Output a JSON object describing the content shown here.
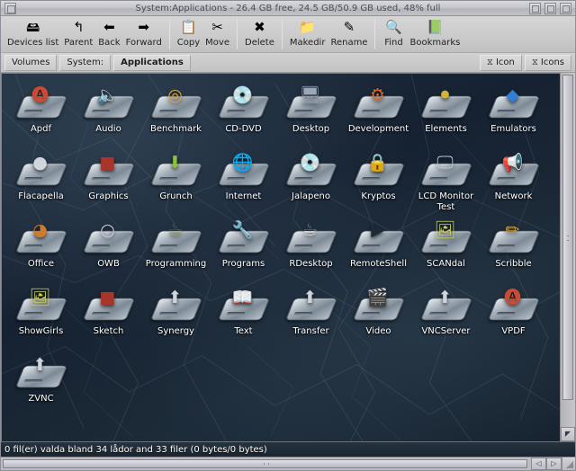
{
  "window": {
    "title": "System:Applications - 26.4 GB free, 24.5 GB/50.9 GB used, 48% full",
    "close_label": "",
    "iconify_label": "",
    "zoom_label": "",
    "depth_label": ""
  },
  "toolbar": {
    "items": [
      {
        "label": "Devices list",
        "icon": "devices-list-icon",
        "glyph": "🖴"
      },
      {
        "label": "Parent",
        "icon": "parent-arrow-icon",
        "glyph": "↰"
      },
      {
        "label": "Back",
        "icon": "back-arrow-icon",
        "glyph": "⬅"
      },
      {
        "label": "Forward",
        "icon": "forward-arrow-icon",
        "glyph": "➡"
      },
      {
        "label": "Copy",
        "icon": "copy-icon",
        "glyph": "📋"
      },
      {
        "label": "Move",
        "icon": "move-icon",
        "glyph": "✂"
      },
      {
        "label": "Delete",
        "icon": "delete-icon",
        "glyph": "✖"
      },
      {
        "label": "Makedir",
        "icon": "makedir-icon",
        "glyph": "📁"
      },
      {
        "label": "Rename",
        "icon": "rename-pencil-icon",
        "glyph": "✎"
      },
      {
        "label": "Find",
        "icon": "find-magnifier-icon",
        "glyph": "🔍"
      },
      {
        "label": "Bookmarks",
        "icon": "bookmarks-icon",
        "glyph": "📗"
      }
    ],
    "separators_after": [
      3,
      5,
      6,
      8
    ]
  },
  "pathbar": {
    "crumbs": [
      {
        "label": "Volumes",
        "current": false
      },
      {
        "label": "System:",
        "current": false
      },
      {
        "label": "Applications",
        "current": true
      }
    ],
    "view_buttons": [
      {
        "label": "Icon",
        "icon": "hourglass-icon"
      },
      {
        "label": "Icons",
        "icon": "hourglass-icon"
      }
    ]
  },
  "files": {
    "items": [
      {
        "name": "Apdf",
        "glyph": "🅐",
        "color": "#c94a35"
      },
      {
        "name": "Audio",
        "glyph": "🔈",
        "color": "#6b6b55"
      },
      {
        "name": "Benchmark",
        "glyph": "◎",
        "color": "#d9a43a"
      },
      {
        "name": "CD-DVD",
        "glyph": "💿",
        "color": "#d8d8d0"
      },
      {
        "name": "Desktop",
        "glyph": "🖥",
        "color": "#9aa8b8"
      },
      {
        "name": "Development",
        "glyph": "⚙",
        "color": "#d96a2a"
      },
      {
        "name": "Elements",
        "glyph": "⚫",
        "color": "#d2b23a"
      },
      {
        "name": "Emulators",
        "glyph": "◆",
        "color": "#2f7fd4"
      },
      {
        "name": "Flacapella",
        "glyph": "●",
        "color": "#cfd6dc"
      },
      {
        "name": "Graphics",
        "glyph": "■",
        "color": "#a8352a"
      },
      {
        "name": "Grunch",
        "glyph": "⬇",
        "color": "#8cc23a"
      },
      {
        "name": "Internet",
        "glyph": "🌐",
        "color": "#6fa8d6"
      },
      {
        "name": "Jalapeno",
        "glyph": "💿",
        "color": "#d0d6dc"
      },
      {
        "name": "Kryptos",
        "glyph": "🔒",
        "color": "#d2a02e"
      },
      {
        "name": "LCD Monitor Test",
        "glyph": "🖵",
        "color": "#bcc6d0"
      },
      {
        "name": "Network",
        "glyph": "📢",
        "color": "#d8cfc2"
      },
      {
        "name": "Office",
        "glyph": "◕",
        "color": "#cf7a2c"
      },
      {
        "name": "OWB",
        "glyph": "○",
        "color": "#c8cfd6"
      },
      {
        "name": "Programming",
        "glyph": "☕",
        "color": "#97a05e"
      },
      {
        "name": "Programs",
        "glyph": "🔧",
        "color": "#c6c2b4"
      },
      {
        "name": "RDesktop",
        "glyph": "☕",
        "color": "#ddd6cc"
      },
      {
        "name": "RemoteShell",
        "glyph": "▶",
        "color": "#1e2a34"
      },
      {
        "name": "SCANdal",
        "glyph": "🖼",
        "color": "#c8cf52"
      },
      {
        "name": "Scribble",
        "glyph": "✏",
        "color": "#e0a830"
      },
      {
        "name": "ShowGirls",
        "glyph": "🖼",
        "color": "#c8cf52"
      },
      {
        "name": "Sketch",
        "glyph": "■",
        "color": "#a8352a"
      },
      {
        "name": "Synergy",
        "glyph": "⬆",
        "color": "#cdd4dc"
      },
      {
        "name": "Text",
        "glyph": "📖",
        "color": "#ddd2be"
      },
      {
        "name": "Transfer",
        "glyph": "⬆",
        "color": "#cdd4dc"
      },
      {
        "name": "Video",
        "glyph": "🎬",
        "color": "#cfd6dc"
      },
      {
        "name": "VNCServer",
        "glyph": "⬆",
        "color": "#cdd4dc"
      },
      {
        "name": "VPDF",
        "glyph": "🅐",
        "color": "#c94a35"
      },
      {
        "name": "ZVNC",
        "glyph": "⬆",
        "color": "#cdd4dc"
      }
    ]
  },
  "statusbar": {
    "text": "0 fil(er) valda bland 34 lådor and 33 filer (0 bytes/0 bytes)"
  },
  "scrollbars": {
    "left_arrow": "◁",
    "right_arrow": "▷"
  }
}
